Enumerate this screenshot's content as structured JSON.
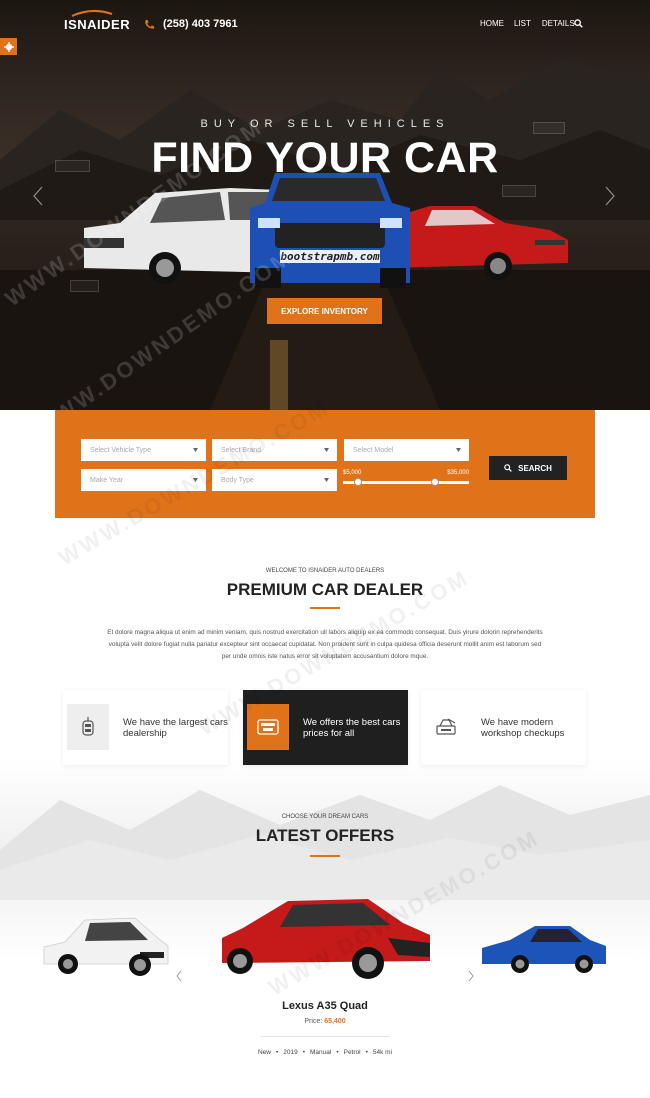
{
  "nav": {
    "logo": "ISNAIDER",
    "phone": "(258) 403 7961",
    "menu": [
      "HOME",
      "LIST",
      "DETAILS"
    ]
  },
  "hero": {
    "tagline": "BUY OR SELL VEHICLES",
    "headline": "FIND YOUR CAR",
    "cta": "EXPLORE INVENTORY",
    "plate_text": "bootstrapmb.com"
  },
  "search": {
    "vehicle_type_placeholder": "Select Vehicle Type",
    "brand_placeholder": "Select Brand",
    "model_placeholder": "Select Model",
    "year_placeholder": "Make Year",
    "body_placeholder": "Body Type",
    "price_min": "$5,000",
    "price_max": "$35,000",
    "button": "SEARCH"
  },
  "intro": {
    "kicker": "WELCOME TO ISNAIDER AUTO DEALERS",
    "title": "PREMIUM CAR DEALER",
    "text": "Et dolore magna aliqua ut enim ad minim veniam, quis nostrud exercitation ull labors aliquip ex ea commodo consequat. Duis yirure dolorin reprehenderits volupta velit dolore fugiat nulla pariatur excepteur sint occaecat cupidatat. Non proident sunt in culpa quidesa officia deserunt mollit anim est laborum sed per unde omnis iste natus error sit voluptatem accusantium dolore mque."
  },
  "features": [
    {
      "text": "We have the largest cars dealership",
      "icon": "car-key-icon"
    },
    {
      "text": "We offers the best cars prices for all",
      "icon": "price-tag-icon"
    },
    {
      "text": "We have modern workshop checkups",
      "icon": "workshop-icon"
    }
  ],
  "offers": {
    "kicker": "CHOOSE YOUR DREAM CARS",
    "title": "LATEST OFFERS",
    "featured_name": "Lexus A35 Quad",
    "price_label": "Price:",
    "price_value": "65,400",
    "specs": [
      "New",
      "2019",
      "Manual",
      "Petrol",
      "54k mi"
    ]
  },
  "colors": {
    "accent": "#e0731a",
    "dark": "#1f1f1f"
  },
  "watermark": "WWW.DOWNDEMO.COM"
}
